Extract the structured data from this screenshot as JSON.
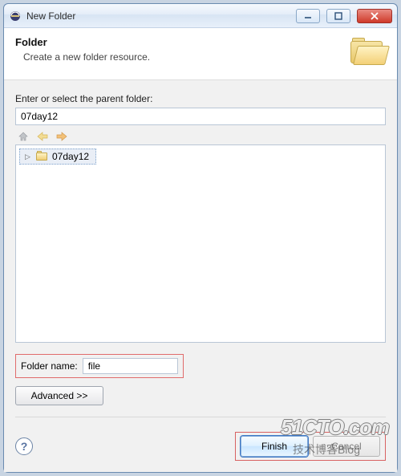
{
  "titlebar": {
    "title": "New Folder"
  },
  "banner": {
    "title": "Folder",
    "subtitle": "Create a new folder resource."
  },
  "parent": {
    "label": "Enter or select the parent folder:",
    "value": "07day12",
    "tree_item": "07day12"
  },
  "foldername": {
    "label": "Folder name:",
    "value": "file"
  },
  "buttons": {
    "advanced": "Advanced >>",
    "finish": "Finish",
    "cancel": "Cancel"
  },
  "icons": {
    "home": "⌂",
    "back": "⇦",
    "forward": "⇨",
    "help": "?"
  },
  "watermark": {
    "main": "51CTO.com",
    "sub": "技术博客Blog"
  }
}
